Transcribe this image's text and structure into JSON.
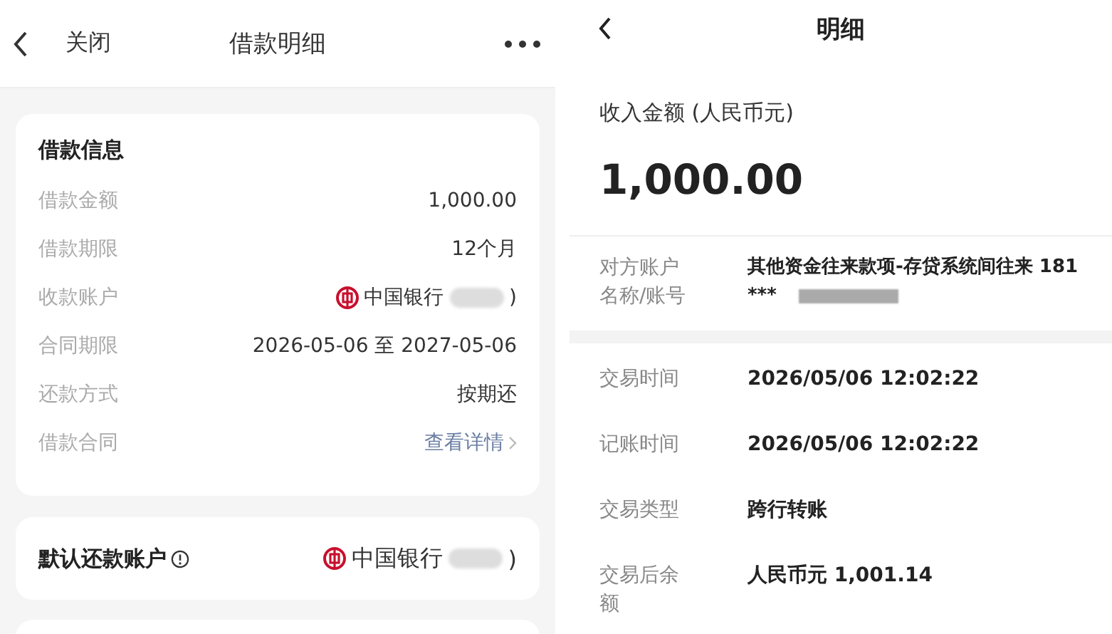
{
  "loan_screen": {
    "header": {
      "close": "关闭",
      "title": "借款明细"
    },
    "info_card": {
      "title": "借款信息",
      "rows": [
        {
          "kind": "text",
          "label": "借款金额",
          "value": "1,000.00"
        },
        {
          "kind": "text",
          "label": "借款期限",
          "value": "12个月"
        },
        {
          "kind": "bank",
          "label": "收款账户",
          "value": "中国银行",
          "suffix": ")"
        },
        {
          "kind": "text",
          "label": "合同期限",
          "value": "2026-05-06 至 2027-05-06"
        },
        {
          "kind": "text",
          "label": "还款方式",
          "value": "按期还"
        },
        {
          "kind": "link",
          "label": "借款合同",
          "value": "查看详情"
        }
      ]
    },
    "repay_card": {
      "title": "默认还款账户",
      "value": "中国银行",
      "suffix": ")"
    }
  },
  "detail_screen": {
    "header": {
      "title": "明细"
    },
    "amount_label": "收入金额 (人民币元)",
    "amount": "1,000.00",
    "counterparty": {
      "label": "对方账户名称/账号",
      "name": "其他资金往来款项-存贷系统间往来 181",
      "account": "***"
    },
    "rows": [
      {
        "label": "交易时间",
        "value": "2026/05/06 12:02:22"
      },
      {
        "label": "记账时间",
        "value": "2026/05/06 12:02:22"
      },
      {
        "label": "交易类型",
        "value": "跨行转账"
      },
      {
        "label": "交易后余额",
        "value": "人民币元 1,001.14"
      }
    ]
  }
}
